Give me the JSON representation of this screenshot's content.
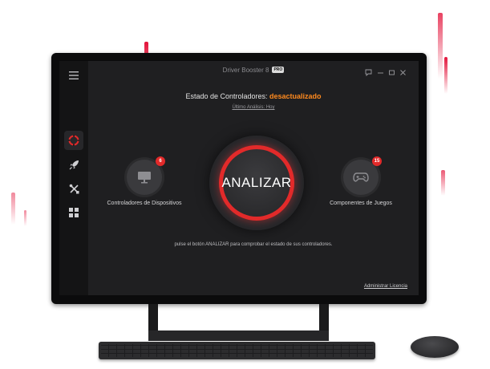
{
  "app": {
    "title": "Driver Booster 8",
    "edition_badge": "PRO"
  },
  "header": {
    "status_label": "Estado de Controladores:",
    "status_value": "desactualizado",
    "last_scan_link": "Último Análisis: Hoy"
  },
  "scan": {
    "button_label": "ANALIZAR"
  },
  "features": [
    {
      "label": "Controladores de Dispositivos",
      "count": "6",
      "icon": "monitor-icon"
    },
    {
      "label": "Componentes de Juegos",
      "count": "15",
      "icon": "gamepad-icon"
    }
  ],
  "hint": "pulse el botón ANALIZAR para comprobar el estado de sus controladores.",
  "footer": {
    "license_link": "Administrar Licencia"
  },
  "sidebar": [
    "menu-icon",
    "lifebuoy-icon",
    "rocket-icon",
    "tools-icon",
    "apps-grid-icon"
  ],
  "colors": {
    "accent": "#e22a2a",
    "status_warning": "#ff8a1e",
    "background": "#1f1f21"
  }
}
